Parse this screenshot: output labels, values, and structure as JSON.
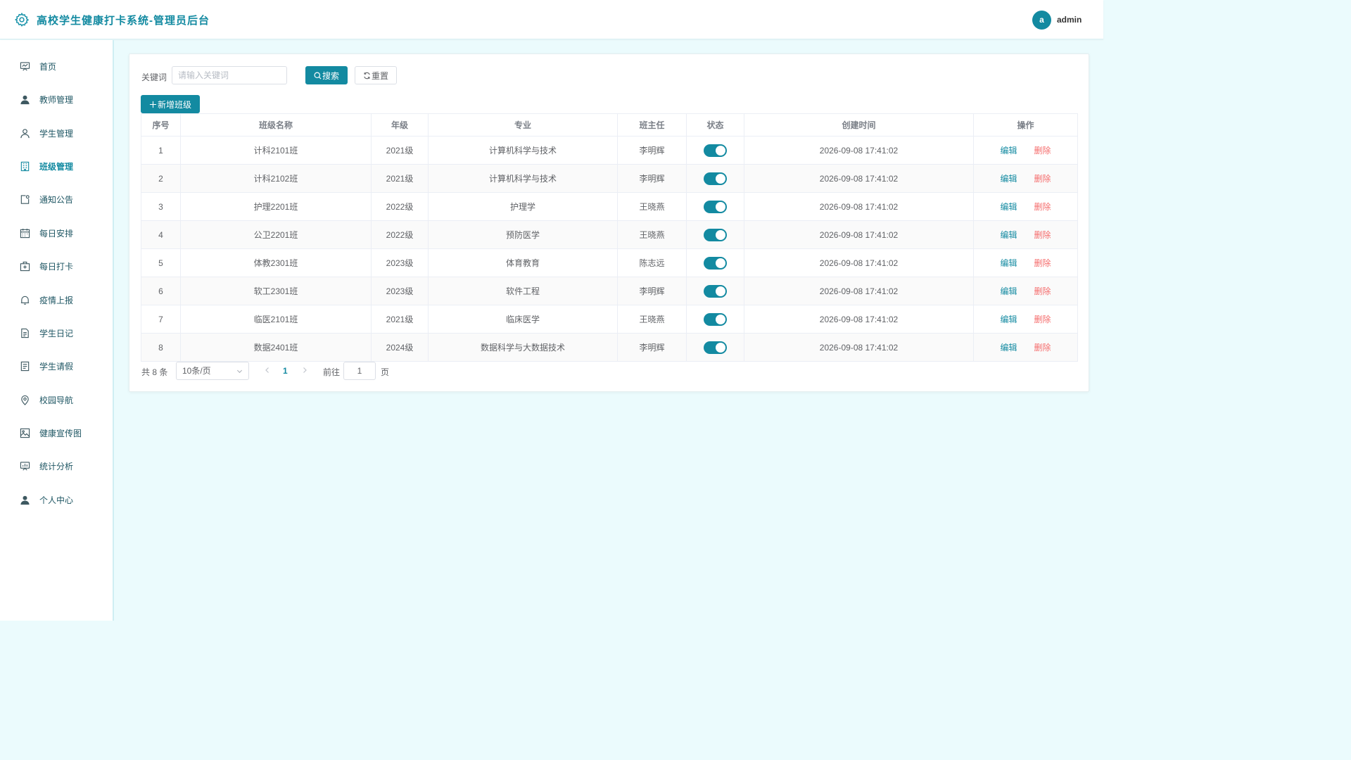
{
  "header": {
    "title": "高校学生健康打卡系统-管理员后台",
    "avatar_letter": "a",
    "username": "admin"
  },
  "sidebar": {
    "items": [
      {
        "label": "首页",
        "icon": "dashboard-icon"
      },
      {
        "label": "教师管理",
        "icon": "user-filled-icon"
      },
      {
        "label": "学生管理",
        "icon": "user-icon"
      },
      {
        "label": "班级管理",
        "icon": "building-icon",
        "active": true
      },
      {
        "label": "通知公告",
        "icon": "notice-icon"
      },
      {
        "label": "每日安排",
        "icon": "calendar-icon"
      },
      {
        "label": "每日打卡",
        "icon": "first-aid-kit-icon"
      },
      {
        "label": "疫情上报",
        "icon": "bell-icon"
      },
      {
        "label": "学生日记",
        "icon": "document-icon"
      },
      {
        "label": "学生请假",
        "icon": "tickets-icon"
      },
      {
        "label": "校园导航",
        "icon": "location-icon"
      },
      {
        "label": "健康宣传图",
        "icon": "picture-icon"
      },
      {
        "label": "统计分析",
        "icon": "data-board-icon"
      },
      {
        "label": "个人中心",
        "icon": "user-filled-icon"
      }
    ]
  },
  "search": {
    "label": "关键词",
    "placeholder": "请输入关键词",
    "value": "",
    "search_label": "搜索",
    "reset_label": "重置"
  },
  "toolbar": {
    "add_label": "新增班级"
  },
  "table": {
    "columns": [
      "序号",
      "班级名称",
      "年级",
      "专业",
      "班主任",
      "状态",
      "创建时间",
      "操作"
    ],
    "edit_label": "编辑",
    "delete_label": "删除",
    "rows": [
      {
        "no": "1",
        "name": "计科2101班",
        "grade": "2021级",
        "major": "计算机科学与技术",
        "teacher": "李明辉",
        "status": true,
        "created": "2026-09-08 17:41:02"
      },
      {
        "no": "2",
        "name": "计科2102班",
        "grade": "2021级",
        "major": "计算机科学与技术",
        "teacher": "李明辉",
        "status": true,
        "created": "2026-09-08 17:41:02"
      },
      {
        "no": "3",
        "name": "护理2201班",
        "grade": "2022级",
        "major": "护理学",
        "teacher": "王晓燕",
        "status": true,
        "created": "2026-09-08 17:41:02"
      },
      {
        "no": "4",
        "name": "公卫2201班",
        "grade": "2022级",
        "major": "预防医学",
        "teacher": "王晓燕",
        "status": true,
        "created": "2026-09-08 17:41:02"
      },
      {
        "no": "5",
        "name": "体教2301班",
        "grade": "2023级",
        "major": "体育教育",
        "teacher": "陈志远",
        "status": true,
        "created": "2026-09-08 17:41:02"
      },
      {
        "no": "6",
        "name": "软工2301班",
        "grade": "2023级",
        "major": "软件工程",
        "teacher": "李明辉",
        "status": true,
        "created": "2026-09-08 17:41:02"
      },
      {
        "no": "7",
        "name": "临医2101班",
        "grade": "2021级",
        "major": "临床医学",
        "teacher": "王晓燕",
        "status": true,
        "created": "2026-09-08 17:41:02"
      },
      {
        "no": "8",
        "name": "数据2401班",
        "grade": "2024级",
        "major": "数据科学与大数据技术",
        "teacher": "李明辉",
        "status": true,
        "created": "2026-09-08 17:41:02"
      }
    ]
  },
  "pagination": {
    "total_text": "共 8 条",
    "page_size": "10条/页",
    "current_page": "1",
    "goto_label": "前往",
    "goto_value": "1",
    "page_suffix": "页"
  },
  "colors": {
    "primary": "#138aa1",
    "danger": "#f56c6c",
    "background": "#ebfbfd"
  }
}
